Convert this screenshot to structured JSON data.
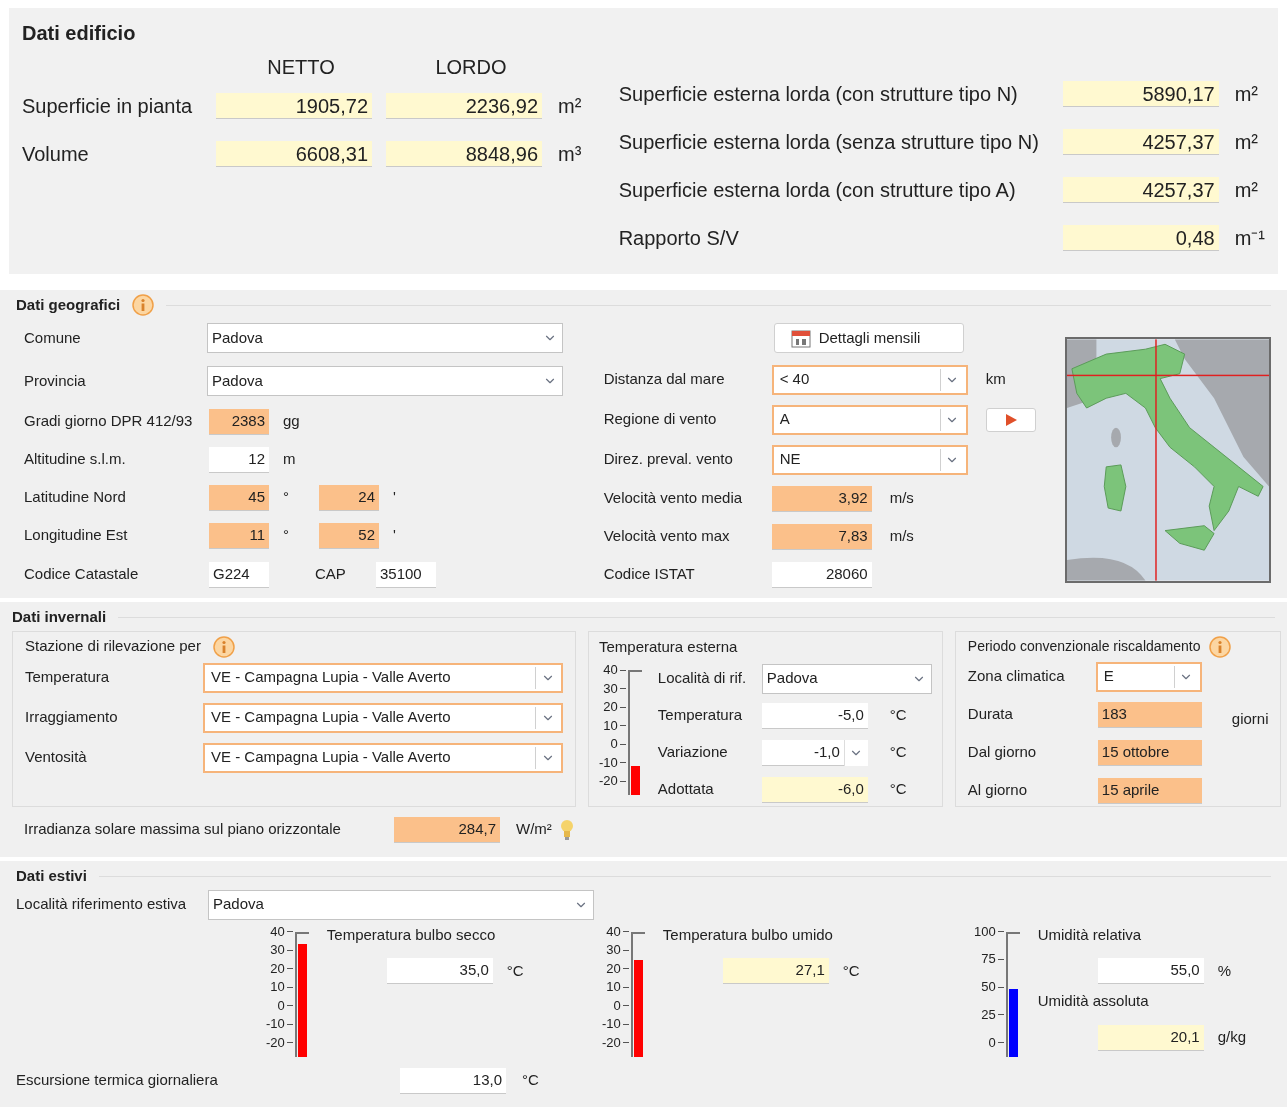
{
  "building": {
    "title": "Dati edificio",
    "columns": [
      "NETTO",
      "LORDO"
    ],
    "areas": [
      {
        "label": "Superficie in pianta",
        "netto": "1905,72",
        "lordo": "2236,92",
        "unit": "m²"
      },
      {
        "label": "Volume",
        "netto": "6608,31",
        "lordo": "8848,96",
        "unit": "m³"
      }
    ],
    "surfaces": [
      {
        "label": "Superficie esterna lorda (con strutture tipo N)",
        "value": "5890,17",
        "unit": "m²"
      },
      {
        "label": "Superficie esterna lorda (senza strutture tipo N)",
        "value": "4257,37",
        "unit": "m²"
      },
      {
        "label": "Superficie esterna lorda (con strutture tipo A)",
        "value": "4257,37",
        "unit": "m²"
      },
      {
        "label": "Rapporto S/V",
        "value": "0,48",
        "unit": "m⁻¹"
      }
    ]
  },
  "geo": {
    "title": "Dati geografici",
    "dropdowns": [
      {
        "label": "Comune",
        "value": "Padova",
        "highlighted": false
      },
      {
        "label": "Provincia",
        "value": "Padova",
        "highlighted": false
      }
    ],
    "fields": [
      {
        "label": "Gradi giorno DPR 412/93",
        "values": [
          {
            "value": "2383",
            "kind": "calculated",
            "unit": "gg"
          }
        ]
      },
      {
        "label": "Altitudine s.l.m.",
        "values": [
          {
            "value": "12",
            "kind": "input",
            "unit": "m"
          }
        ]
      },
      {
        "label": "Latitudine Nord",
        "values": [
          {
            "value": "45",
            "kind": "calculated",
            "unit": "°"
          },
          {
            "value": "24",
            "kind": "calculated",
            "unit": "'"
          }
        ]
      },
      {
        "label": "Longitudine Est",
        "values": [
          {
            "value": "11",
            "kind": "calculated",
            "unit": "°"
          },
          {
            "value": "52",
            "kind": "calculated",
            "unit": "'"
          }
        ]
      }
    ],
    "catastale": {
      "label": "Codice Catastale",
      "value": "G224"
    },
    "cap": {
      "label": "CAP",
      "value": "35100"
    },
    "button": "Dettagli mensili",
    "wind": [
      {
        "label": "Distanza dal mare",
        "kind": "dropdown",
        "value": "< 40",
        "highlighted": true,
        "unit": "km",
        "play_button": false
      },
      {
        "label": "Regione di vento",
        "kind": "dropdown",
        "value": "A",
        "highlighted": true,
        "play_button": true
      },
      {
        "label": "Direz. preval. vento",
        "kind": "dropdown",
        "value": "NE",
        "highlighted": true,
        "play_button": false
      },
      {
        "label": "Velocità vento media",
        "kind": "calculated",
        "value": "3,92",
        "unit": "m/s"
      },
      {
        "label": "Velocità vento max",
        "kind": "calculated",
        "value": "7,83",
        "unit": "m/s"
      },
      {
        "label": "Codice ISTAT",
        "kind": "input",
        "value": "28060"
      }
    ]
  },
  "winter": {
    "title": "Dati invernali",
    "stations": {
      "title": "Stazione di rilevazione per",
      "rows": [
        {
          "label": "Temperatura",
          "value": "VE - Campagna Lupia - Valle Averto",
          "highlighted": true
        },
        {
          "label": "Irraggiamento",
          "value": "VE - Campagna Lupia - Valle Averto",
          "highlighted": true
        },
        {
          "label": "Ventosità",
          "value": "VE - Campagna Lupia - Valle Averto",
          "highlighted": true
        }
      ]
    },
    "external": {
      "title": "Temperatura esterna",
      "gauge": {
        "ticks": [
          "40",
          "30",
          "20",
          "10",
          "0",
          "-10",
          "-20"
        ],
        "level": 0.233,
        "color": "#ff0000"
      },
      "locality": {
        "label": "Località di rif.",
        "value": "Padova",
        "highlighted": false
      },
      "rows": [
        {
          "label": "Temperatura",
          "value": "-5,0",
          "kind": "input",
          "unit": "°C",
          "dropdown": false
        },
        {
          "label": "Variazione",
          "value": "-1,0",
          "kind": "input",
          "unit": "°C",
          "dropdown": true
        },
        {
          "label": "Adottata",
          "value": "-6,0",
          "kind": "result",
          "unit": "°C",
          "dropdown": false
        }
      ]
    },
    "period": {
      "title": "Periodo convenzionale riscaldamento",
      "zone": {
        "label": "Zona climatica",
        "value": "E",
        "highlighted": true
      },
      "rows": [
        {
          "label": "Durata",
          "value": "183",
          "kind": "calculated",
          "unit": "giorni"
        },
        {
          "label": "Dal giorno",
          "value": "15 ottobre",
          "kind": "calculated"
        },
        {
          "label": "Al giorno",
          "value": "15 aprile",
          "kind": "calculated"
        }
      ]
    },
    "irradiance": {
      "label": "Irradianza solare massima sul piano orizzontale",
      "value": "284,7",
      "kind": "calculated",
      "unit": "W/m²"
    }
  },
  "summer": {
    "title": "Dati estivi",
    "locality": {
      "label": "Località riferimento estiva",
      "value": "Padova",
      "highlighted": false
    },
    "gauges": [
      {
        "ticks": [
          "40",
          "30",
          "20",
          "10",
          "0",
          "-10",
          "-20"
        ],
        "level": 0.917,
        "color": "#ff0000",
        "fields": [
          {
            "label": "Temperatura bulbo secco",
            "value": "35,0",
            "kind": "input",
            "unit": "°C"
          }
        ]
      },
      {
        "ticks": [
          "40",
          "30",
          "20",
          "10",
          "0",
          "-10",
          "-20"
        ],
        "level": 0.785,
        "color": "#ff0000",
        "fields": [
          {
            "label": "Temperatura bulbo umido",
            "value": "27,1",
            "kind": "result",
            "unit": "°C"
          }
        ]
      },
      {
        "ticks": [
          "100",
          "75",
          "50",
          "25",
          "0"
        ],
        "level": 0.55,
        "color": "#0000ff",
        "fields": [
          {
            "label": "Umidità relativa",
            "value": "55,0",
            "kind": "input",
            "unit": "%"
          },
          {
            "label": "Umidità assoluta",
            "value": "20,1",
            "kind": "result",
            "unit": "g/kg"
          }
        ]
      }
    ],
    "excursion": {
      "label": "Escursione termica giornaliera",
      "value": "13,0",
      "kind": "input",
      "unit": "°C"
    }
  }
}
